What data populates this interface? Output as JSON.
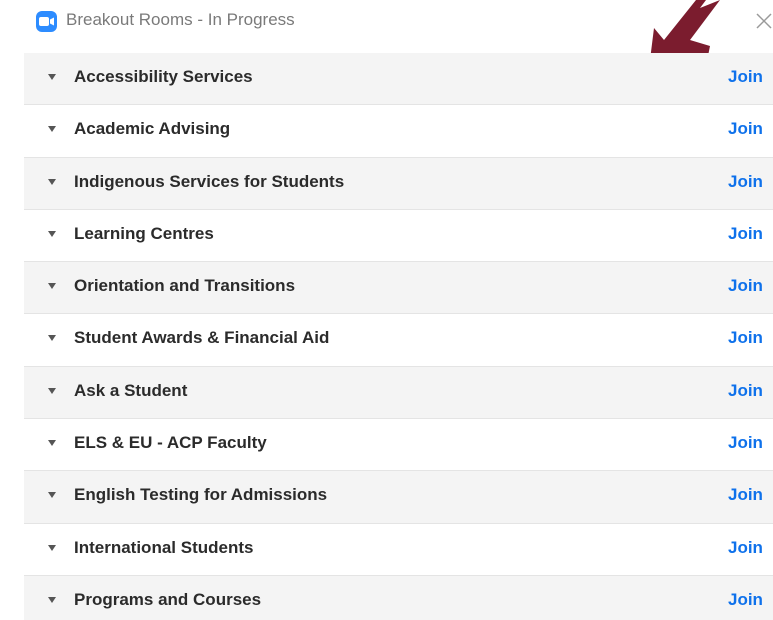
{
  "window": {
    "title": "Breakout Rooms - In Progress",
    "app_icon": "zoom-camera-icon",
    "close_icon": "close-icon"
  },
  "colors": {
    "accent": "#0e71eb",
    "app_icon_bg": "#2d8cff",
    "annotation_arrow": "#7b1c2e",
    "row_alt": "#f4f4f4"
  },
  "rooms": [
    {
      "name": "Accessibility Services",
      "action": "Join"
    },
    {
      "name": "Academic Advising",
      "action": "Join"
    },
    {
      "name": "Indigenous Services for Students",
      "action": "Join"
    },
    {
      "name": "Learning Centres",
      "action": "Join"
    },
    {
      "name": "Orientation and Transitions",
      "action": "Join"
    },
    {
      "name": "Student Awards & Financial Aid",
      "action": "Join"
    },
    {
      "name": "Ask a Student",
      "action": "Join"
    },
    {
      "name": "ELS & EU - ACP Faculty",
      "action": "Join"
    },
    {
      "name": "English Testing for Admissions",
      "action": "Join"
    },
    {
      "name": "International Students",
      "action": "Join"
    },
    {
      "name": "Programs and Courses",
      "action": "Join"
    }
  ]
}
